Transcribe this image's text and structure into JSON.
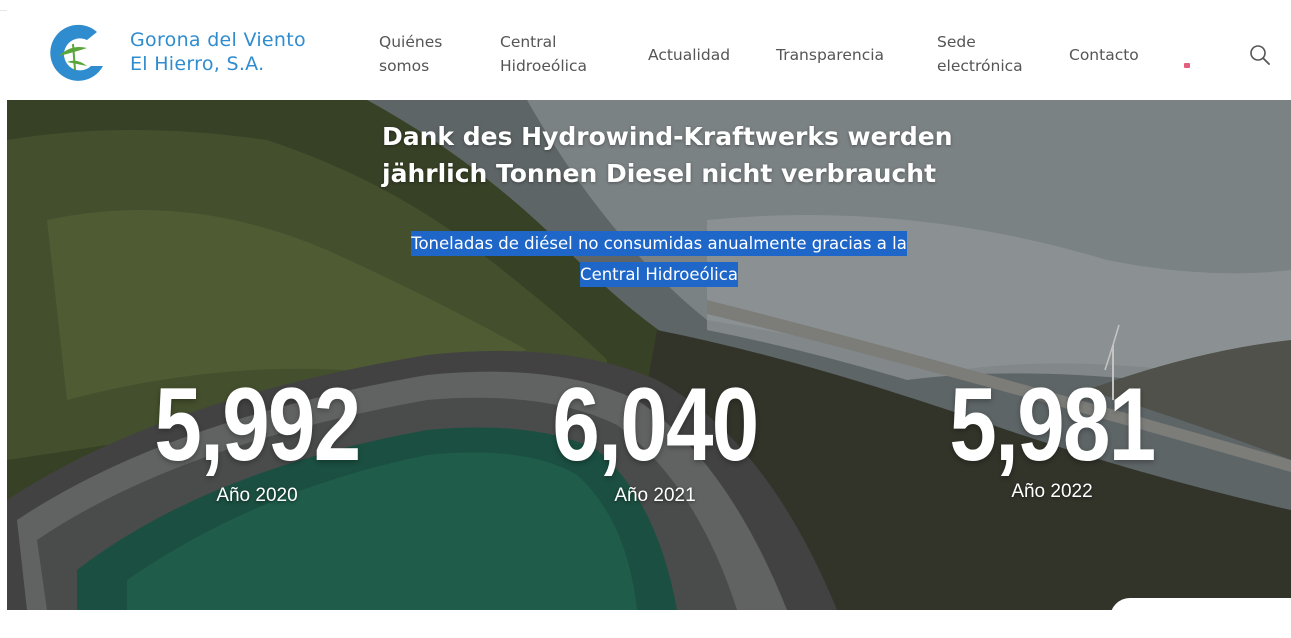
{
  "brand": {
    "line1": "Gorona del Viento",
    "line2": "El Hierro, S.A.",
    "accent_color": "#2f8ccf",
    "leaf_color": "#5aa63a"
  },
  "nav": {
    "quienes_line1": "Quiénes",
    "quienes_line2": "somos",
    "central_line1": "Central",
    "central_line2": "Hidroeólica",
    "actualidad": "Actualidad",
    "transparencia": "Transparencia",
    "sede_line1": "Sede",
    "sede_line2": "electrónica",
    "contacto": "Contacto",
    "flag_icon": "flag-icon",
    "search_icon": "search-icon"
  },
  "hero": {
    "headline_line1": "Dank des Hydrowind-Kraftwerks werden",
    "headline_line2": "jährlich Tonnen Diesel nicht verbraucht",
    "sub_line1": "Toneladas de diésel no consumidas anualmente gracias a la",
    "sub_line2": "Central Hidroeólica",
    "highlight_color": "#1e67c9",
    "stats": [
      {
        "value": "5,992",
        "label": "Año 2020"
      },
      {
        "value": "6,040",
        "label": "Año 2021"
      },
      {
        "value": "5,981",
        "label": "Año 2022"
      }
    ]
  }
}
